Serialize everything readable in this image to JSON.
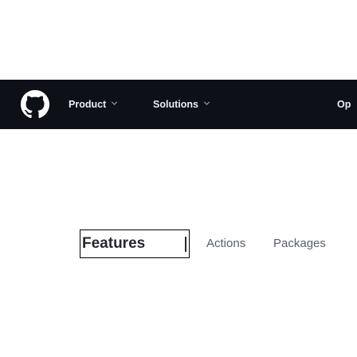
{
  "header": {
    "logo_icon": "github-logo-icon",
    "nav": [
      {
        "label": "Product",
        "has_dropdown": true
      },
      {
        "label": "Solutions",
        "has_dropdown": true
      },
      {
        "label": "Op",
        "has_dropdown": false
      }
    ],
    "background": "#0d1117",
    "text_color": "#e6edf3"
  },
  "subnav": {
    "tabs": [
      {
        "label": "Features",
        "selected": true
      },
      {
        "label": "Actions",
        "selected": false
      },
      {
        "label": "Packages",
        "selected": false
      }
    ]
  }
}
